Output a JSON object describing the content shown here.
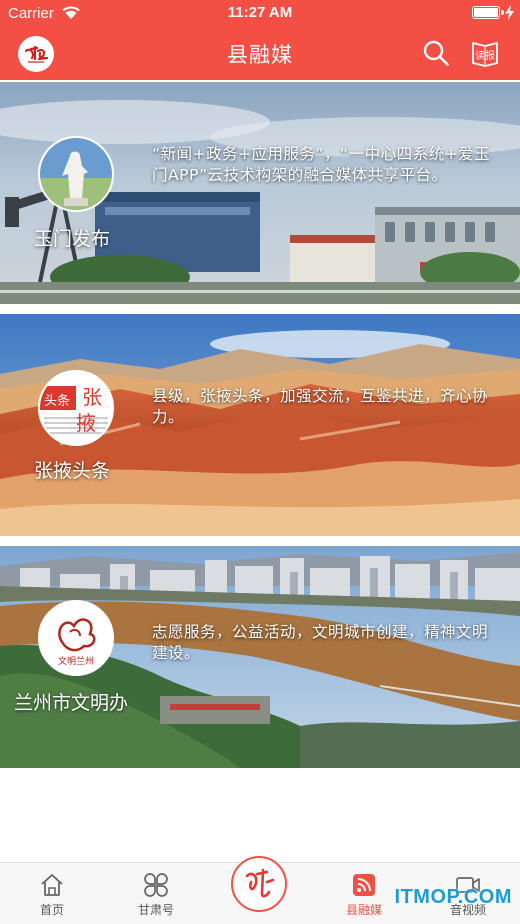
{
  "status_bar": {
    "carrier": "Carrier",
    "time": "11:27 AM",
    "battery_level": 1.0
  },
  "nav": {
    "title": "县融媒",
    "logo_icon": "gansu-logo-icon",
    "search_icon": "search-icon",
    "report_icon": "newspaper-report-icon",
    "report_label": "读报"
  },
  "cards": [
    {
      "name": "玉门发布",
      "description": "“新闻+政务+应用服务”，“一中心四系统+爱玉门APP”云技术构架的融合媒体共享平台。",
      "avatar_icon": "statue-avatar-icon"
    },
    {
      "name": "张掖头条",
      "description": "县级，张掖头条，加强交流，互鉴共进，齐心协力。",
      "avatar_icon": "zhangye-toutiao-logo-icon",
      "avatar_text": [
        "头条",
        "张",
        "掖"
      ]
    },
    {
      "name": "兰州市文明办",
      "description": "志愿服务，公益活动，文明城市创建，精神文明建设。",
      "avatar_icon": "lanzhou-wenming-logo-icon",
      "avatar_text": "文明兰州"
    }
  ],
  "tab_bar": {
    "items": [
      {
        "label": "首页",
        "icon": "home-icon",
        "active": false
      },
      {
        "label": "甘肃号",
        "icon": "grid-clover-icon",
        "active": false
      },
      {
        "label": "县融媒",
        "icon": "rss-feed-icon",
        "active": true
      },
      {
        "label": "音视频",
        "icon": "video-camera-icon",
        "active": false
      }
    ],
    "center_icon": "center-brand-icon"
  },
  "watermark": "ITMOP.COM",
  "colors": {
    "brand_red": "#f34f44",
    "tab_active": "#f34f44",
    "tab_inactive": "#555555",
    "watermark_blue": "#1e9bd7"
  }
}
